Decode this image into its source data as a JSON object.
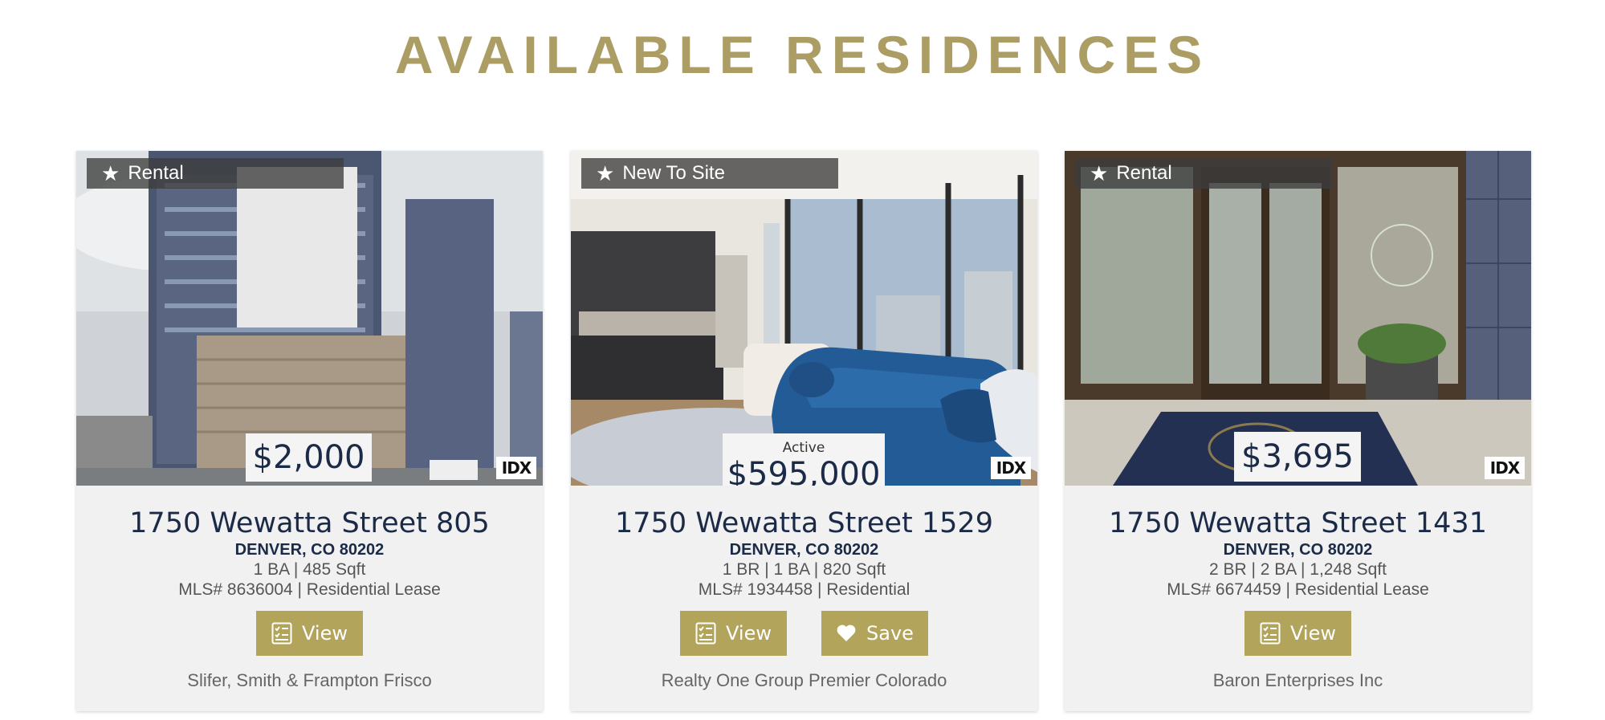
{
  "page": {
    "title": "AVAILABLE RESIDENCES"
  },
  "listings": [
    {
      "tag": "Rental",
      "status": "",
      "price": "$2,000",
      "address": "1750 Wewatta Street 805",
      "city": "DENVER, CO 80202",
      "specs": "1 BA | 485 Sqft",
      "mls": "MLS# 8636004 | Residential Lease",
      "view_label": "View",
      "save_label": "",
      "broker": "Slifer, Smith & Frampton Frisco",
      "idx_label": "IDX"
    },
    {
      "tag": "New To Site",
      "status": "Active",
      "price": "$595,000",
      "address": "1750 Wewatta Street 1529",
      "city": "DENVER, CO 80202",
      "specs": "1 BR | 1 BA | 820 Sqft",
      "mls": "MLS# 1934458 | Residential",
      "view_label": "View",
      "save_label": "Save",
      "broker": "Realty One Group Premier Colorado",
      "idx_label": "IDX"
    },
    {
      "tag": "Rental",
      "status": "",
      "price": "$3,695",
      "address": "1750 Wewatta Street 1431",
      "city": "DENVER, CO 80202",
      "specs": "2 BR | 2 BA | 1,248 Sqft",
      "mls": "MLS# 6674459 | Residential Lease",
      "view_label": "View",
      "save_label": "",
      "broker": "Baron Enterprises Inc",
      "idx_label": "IDX"
    }
  ],
  "icons": {
    "tag": "star-icon",
    "view": "checklist-icon",
    "save": "heart-icon"
  },
  "colors": {
    "accent": "#b3a45c",
    "title": "#ab9d63",
    "navy": "#1b2a47"
  }
}
